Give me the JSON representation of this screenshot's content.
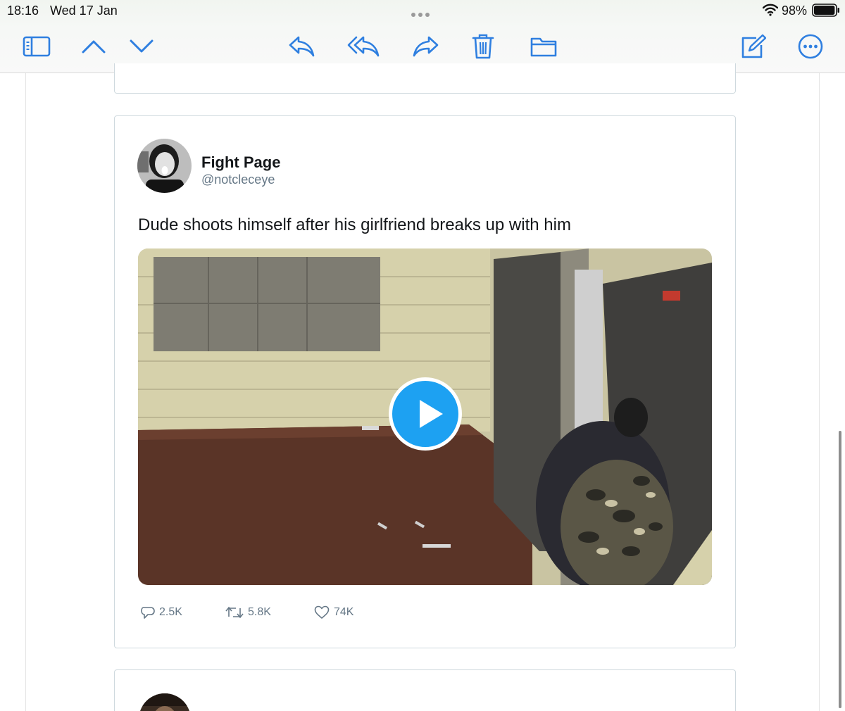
{
  "status_bar": {
    "time": "18:16",
    "date": "Wed 17 Jan",
    "battery_percent": "98%",
    "battery_level": 0.98
  },
  "toolbar": {
    "accent_color": "#2f7fe0",
    "left_icons": [
      "sidebar-icon",
      "chevron-up-icon",
      "chevron-down-icon"
    ],
    "center_icons": [
      "reply-icon",
      "reply-all-icon",
      "forward-icon",
      "trash-icon",
      "folder-icon"
    ],
    "right_icons": [
      "compose-icon",
      "more-icon"
    ]
  },
  "tweet": {
    "author_name": "Fight Page",
    "author_handle": "@notcleceye",
    "text": "Dude shoots himself after his girlfriend breaks up with him",
    "media_type": "video",
    "actions": {
      "reply_count": "2.5K",
      "retweet_count": "5.8K",
      "like_count": "74K"
    }
  },
  "colors": {
    "twitter_blue": "#1da1f2",
    "secondary_text": "#657786",
    "card_border": "#cfd9de"
  }
}
